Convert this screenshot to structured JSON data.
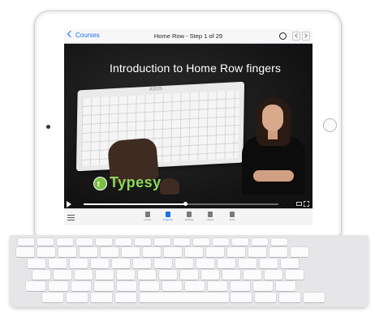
{
  "app": {
    "back_label": "Courses",
    "title": "Home Row - Step 1 of 29"
  },
  "video": {
    "title": "Introduction to Home Row fingers",
    "keyboard_brand": "ASUS",
    "logo_text": "Typesy",
    "progress": 0.52
  },
  "tabbar": {
    "tabs": [
      {
        "label": "Lesson",
        "icon": "book-icon",
        "active": false
      },
      {
        "label": "Progress",
        "icon": "runner-icon",
        "active": true
      },
      {
        "label": "Settings",
        "icon": "gear-icon",
        "active": false
      },
      {
        "label": "Library",
        "icon": "library-icon",
        "active": false
      },
      {
        "label": "Stats",
        "icon": "chart-icon",
        "active": false
      }
    ]
  },
  "colors": {
    "accent": "#1a73e8",
    "logo_green": "#8dd85a",
    "video_bg": "#151515"
  }
}
